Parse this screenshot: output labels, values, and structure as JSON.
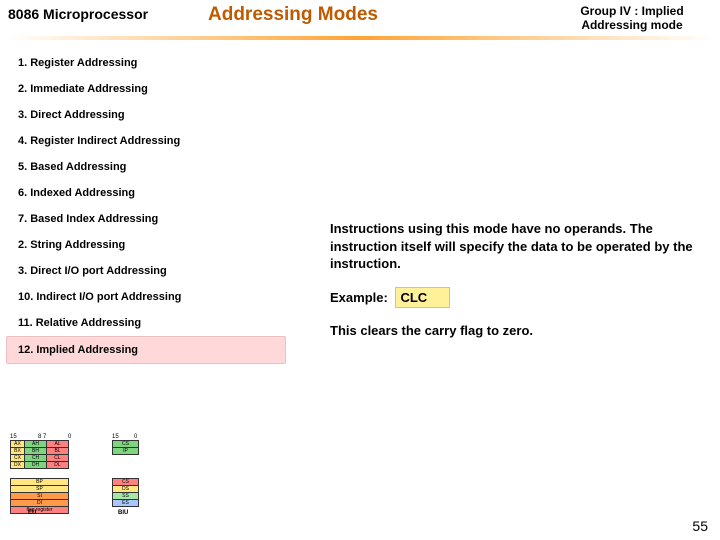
{
  "header": {
    "left": "8086 Microprocessor",
    "title": "Addressing Modes",
    "right_line1": "Group IV : Implied",
    "right_line2": "Addressing mode"
  },
  "modes": [
    {
      "n": "1.",
      "label": "Register Addressing"
    },
    {
      "n": "2.",
      "label": "Immediate Addressing"
    },
    {
      "n": "3.",
      "label": "Direct Addressing"
    },
    {
      "n": "4.",
      "label": "Register Indirect Addressing"
    },
    {
      "n": "5.",
      "label": "Based Addressing"
    },
    {
      "n": "6.",
      "label": "Indexed Addressing"
    },
    {
      "n": "7.",
      "label": "Based Index Addressing"
    },
    {
      "n": "2.",
      "label": "String Addressing"
    },
    {
      "n": "3.",
      "label": "Direct I/O port Addressing"
    },
    {
      "n": "10.",
      "label": "Indirect I/O port Addressing"
    },
    {
      "n": "11.",
      "label": "Relative Addressing"
    },
    {
      "n": "12.",
      "label": "Implied Addressing"
    }
  ],
  "highlight_index": 11,
  "body": {
    "desc": "Instructions using this mode have no operands. The instruction itself will specify the data to be operated by the instruction.",
    "example_label": "Example:",
    "example_code": "CLC",
    "result": "This clears the carry flag to zero."
  },
  "diagram": {
    "ax_rows": [
      [
        "AX",
        "AH",
        "AL"
      ],
      [
        "BX",
        "BH",
        "BL"
      ],
      [
        "CX",
        "CH",
        "CL"
      ],
      [
        "DX",
        "DH",
        "DL"
      ]
    ],
    "cs_rows": [
      [
        "CS"
      ],
      [
        "IP"
      ]
    ],
    "bp_rows": [
      "BP",
      "SP",
      "SI",
      "DI",
      "flag register"
    ],
    "seg_rows": [
      "CS",
      "DS",
      "SS",
      "ES"
    ],
    "label_top_left": "15",
    "label_top_mid": "8 7",
    "label_top_right": "0",
    "label_cs_left": "15",
    "label_cs_right": "0",
    "label_eu": "EU",
    "label_biu": "BIU"
  },
  "page": "55"
}
